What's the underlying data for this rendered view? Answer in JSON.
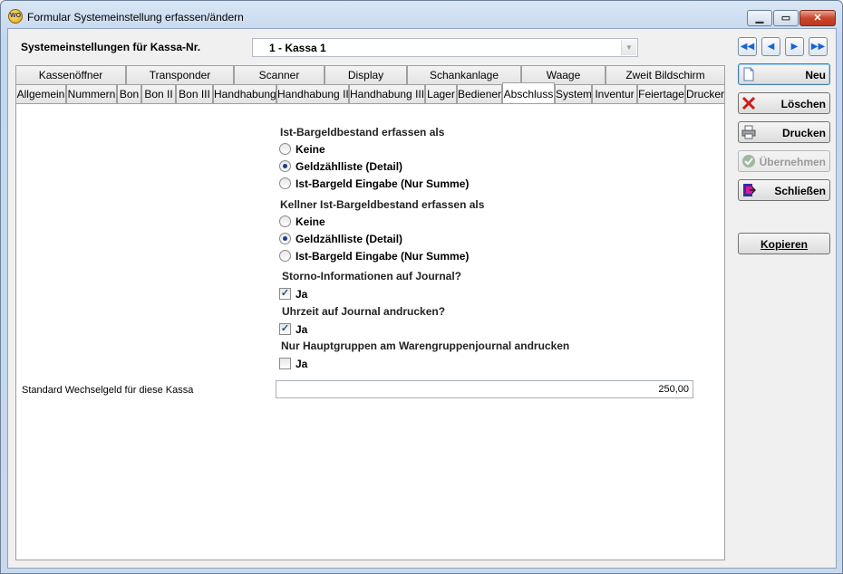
{
  "window": {
    "title": "Formular Systemeinstellung erfassen/ändern",
    "icon": "WO"
  },
  "header": {
    "kassa_label": "Systemeinstellungen für Kassa-Nr.",
    "kassa_value": "1 - Kassa 1"
  },
  "nav": {
    "first": "first-record-icon",
    "prev": "previous-record-icon",
    "next": "next-record-icon",
    "last": "last-record-icon"
  },
  "tabs_row1": [
    "Kassenöffner",
    "Transponder",
    "Scanner",
    "Display",
    "Schankanlage",
    "Waage",
    "Zweit Bildschirm"
  ],
  "tabs_row2": [
    "Allgemein",
    "Nummern",
    "Bon",
    "Bon II",
    "Bon III",
    "Handhabung",
    "Handhabung II",
    "Handhabung III",
    "Lager",
    "Bediener",
    "Abschluss",
    "System",
    "Inventur",
    "Feiertage",
    "Drucker"
  ],
  "active_tab": "Abschluss",
  "section1": {
    "heading": "Ist-Bargeldbestand erfassen als",
    "options": [
      "Keine",
      "Geldzählliste (Detail)",
      "Ist-Bargeld Eingabe (Nur Summe)"
    ],
    "selected": 1
  },
  "section2": {
    "heading": "Kellner Ist-Bargeldbestand erfassen als",
    "options": [
      "Keine",
      "Geldzählliste (Detail)",
      "Ist-Bargeld Eingabe (Nur Summe)"
    ],
    "selected": 1
  },
  "storno": {
    "heading": "Storno-Informationen auf Journal?",
    "label": "Ja",
    "checked": true
  },
  "uhrzeit": {
    "heading": "Uhrzeit auf Journal andrucken?",
    "label": "Ja",
    "checked": true
  },
  "hauptgruppen": {
    "heading": "Nur Hauptgruppen am Warengruppenjournal andrucken",
    "label": "Ja",
    "checked": false
  },
  "wechselgeld": {
    "label": "Standard Wechselgeld für diese Kassa",
    "value": "250,00"
  },
  "buttons": {
    "neu": "Neu",
    "loeschen": "Löschen",
    "drucken": "Drucken",
    "uebernehmen": "Übernehmen",
    "schliessen": "Schließen",
    "kopieren": "Kopieren"
  },
  "colors": {
    "accent": "#1565d8",
    "window_frame": "#c4d7ee",
    "close_button": "#c9452c",
    "delete_red": "#d21a1a"
  }
}
